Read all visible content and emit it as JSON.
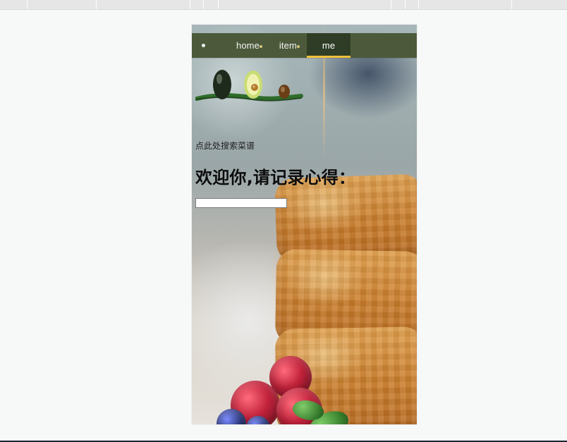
{
  "nav": {
    "items": [
      {
        "label": "home",
        "active": false
      },
      {
        "label": "item",
        "active": false
      },
      {
        "label": "me",
        "active": true
      }
    ]
  },
  "content": {
    "search_link": "点此处搜索菜谱",
    "welcome_title": "欢迎你,请记录心得：",
    "note_input": {
      "value": "",
      "placeholder": ""
    }
  },
  "icons": {
    "nav_leading": "dot-icon",
    "nav_marker": "dot-marker-icon",
    "logo": "avocado-logo-icon"
  },
  "colors": {
    "nav_bg": "#4c5a3b",
    "nav_active_bg": "#2f3d26",
    "nav_active_underline": "#f1c13a"
  }
}
